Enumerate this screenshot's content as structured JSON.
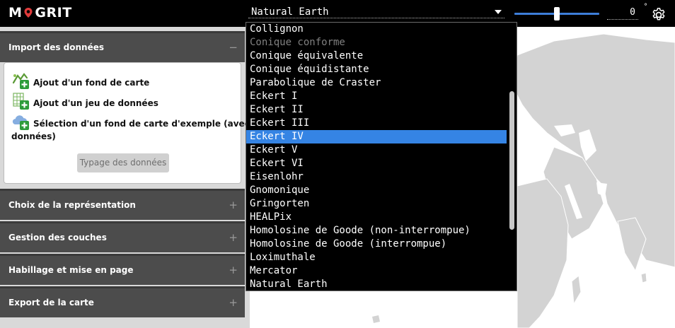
{
  "app": {
    "logo_left": "M",
    "logo_right": "GRIT"
  },
  "toolbar": {
    "projection_value": "Natural Earth",
    "rotation_value": "0",
    "degree_sign": "°"
  },
  "sidebar": {
    "import": {
      "title": "Import des données",
      "toggle": "−",
      "items": [
        {
          "label": "Ajout d'un fond de carte",
          "icon": "basemap-add-icon"
        },
        {
          "label": "Ajout d'un jeu de données",
          "icon": "dataset-add-icon"
        },
        {
          "label_line1": "Sélection d'un fond de carte d'exemple (avec",
          "label_line2": "données)",
          "icon": "cloud-add-icon"
        }
      ],
      "typage_button": "Typage des données"
    },
    "sections": [
      {
        "title": "Choix de la représentation",
        "toggle": "+"
      },
      {
        "title": "Gestion des couches",
        "toggle": "+"
      },
      {
        "title": "Habillage et mise en page",
        "toggle": "+"
      },
      {
        "title": "Export de la carte",
        "toggle": "+"
      }
    ]
  },
  "dropdown": {
    "options": [
      {
        "label": "Collignon",
        "state": "normal"
      },
      {
        "label": "Conique conforme",
        "state": "disabled"
      },
      {
        "label": "Conique équivalente",
        "state": "normal"
      },
      {
        "label": "Conique équidistante",
        "state": "normal"
      },
      {
        "label": "Parabolique de Craster",
        "state": "normal"
      },
      {
        "label": "Eckert I",
        "state": "normal"
      },
      {
        "label": "Eckert II",
        "state": "normal"
      },
      {
        "label": "Eckert III",
        "state": "normal"
      },
      {
        "label": "Eckert IV",
        "state": "selected"
      },
      {
        "label": "Eckert V",
        "state": "normal"
      },
      {
        "label": "Eckert VI",
        "state": "normal"
      },
      {
        "label": "Eisenlohr",
        "state": "normal"
      },
      {
        "label": "Gnomonique",
        "state": "normal"
      },
      {
        "label": "Gringorten",
        "state": "normal"
      },
      {
        "label": "HEALPix",
        "state": "normal"
      },
      {
        "label": "Homolosine de Goode (non-interrompue)",
        "state": "normal"
      },
      {
        "label": "Homolosine de Goode (interrompue)",
        "state": "normal"
      },
      {
        "label": "Loximuthale",
        "state": "normal"
      },
      {
        "label": "Mercator",
        "state": "normal"
      },
      {
        "label": "Natural Earth",
        "state": "normal"
      }
    ]
  },
  "colors": {
    "accent": "#3584e4",
    "header_bg": "#4c4c4c",
    "map_land": "#d3d3d3"
  }
}
